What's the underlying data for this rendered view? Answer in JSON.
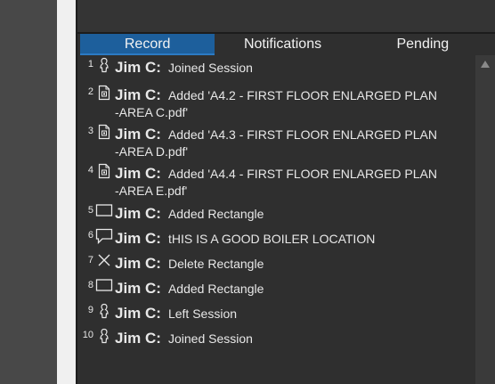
{
  "tabs": [
    {
      "label": "Record",
      "active": true
    },
    {
      "label": "Notifications",
      "active": false
    },
    {
      "label": "Pending",
      "active": false
    }
  ],
  "records": [
    {
      "num": "1",
      "icon": "person-icon",
      "name": "Jim C:",
      "line1": "Joined Session",
      "line2": ""
    },
    {
      "num": "2",
      "icon": "file-icon",
      "name": "Jim C:",
      "line1": "Added 'A4.2 - FIRST FLOOR ENLARGED PLAN",
      "line2": "-AREA C.pdf'"
    },
    {
      "num": "3",
      "icon": "file-icon",
      "name": "Jim C:",
      "line1": "Added 'A4.3 - FIRST FLOOR ENLARGED PLAN",
      "line2": "-AREA D.pdf'"
    },
    {
      "num": "4",
      "icon": "file-icon",
      "name": "Jim C:",
      "line1": "Added 'A4.4 - FIRST FLOOR ENLARGED PLAN",
      "line2": "-AREA E.pdf'"
    },
    {
      "num": "5",
      "icon": "rectangle-icon",
      "name": "Jim C:",
      "line1": "Added Rectangle",
      "line2": ""
    },
    {
      "num": "6",
      "icon": "comment-icon",
      "name": "Jim C:",
      "line1": "tHIS IS A GOOD BOILER LOCATION",
      "line2": ""
    },
    {
      "num": "7",
      "icon": "delete-x-icon",
      "name": "Jim C:",
      "line1": "Delete Rectangle",
      "line2": ""
    },
    {
      "num": "8",
      "icon": "rectangle-icon",
      "name": "Jim C:",
      "line1": "Added Rectangle",
      "line2": ""
    },
    {
      "num": "9",
      "icon": "person-icon",
      "name": "Jim C:",
      "line1": "Left Session",
      "line2": ""
    },
    {
      "num": "10",
      "icon": "person-icon",
      "name": "Jim C:",
      "line1": "Joined Session",
      "line2": ""
    }
  ],
  "colors": {
    "panel_bg": "#2f2f2f",
    "active_tab": "#1d5f9c",
    "text": "#e8e8e8"
  }
}
